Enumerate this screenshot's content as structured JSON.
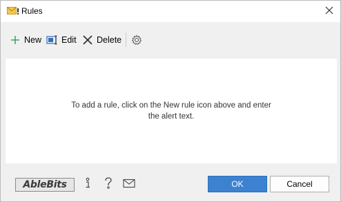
{
  "window": {
    "title": "Rules"
  },
  "toolbar": {
    "new_label": "New",
    "edit_label": "Edit",
    "delete_label": "Delete"
  },
  "content": {
    "hint_line1": "To add a rule, click on the New rule icon above and enter",
    "hint_line2": "the alert text."
  },
  "footer": {
    "logo_text": "AbleBits",
    "ok_label": "OK",
    "cancel_label": "Cancel"
  },
  "colors": {
    "accent": "#3c82d1",
    "content_bg": "#ffffff",
    "window_bg": "#f0f0f0",
    "new_icon": "#2e9e57"
  },
  "icons": [
    "mail-alert-icon",
    "close-icon",
    "plus-icon",
    "edit-icon",
    "delete-icon",
    "settings-gear-icon",
    "info-icon",
    "help-icon",
    "envelope-icon"
  ]
}
